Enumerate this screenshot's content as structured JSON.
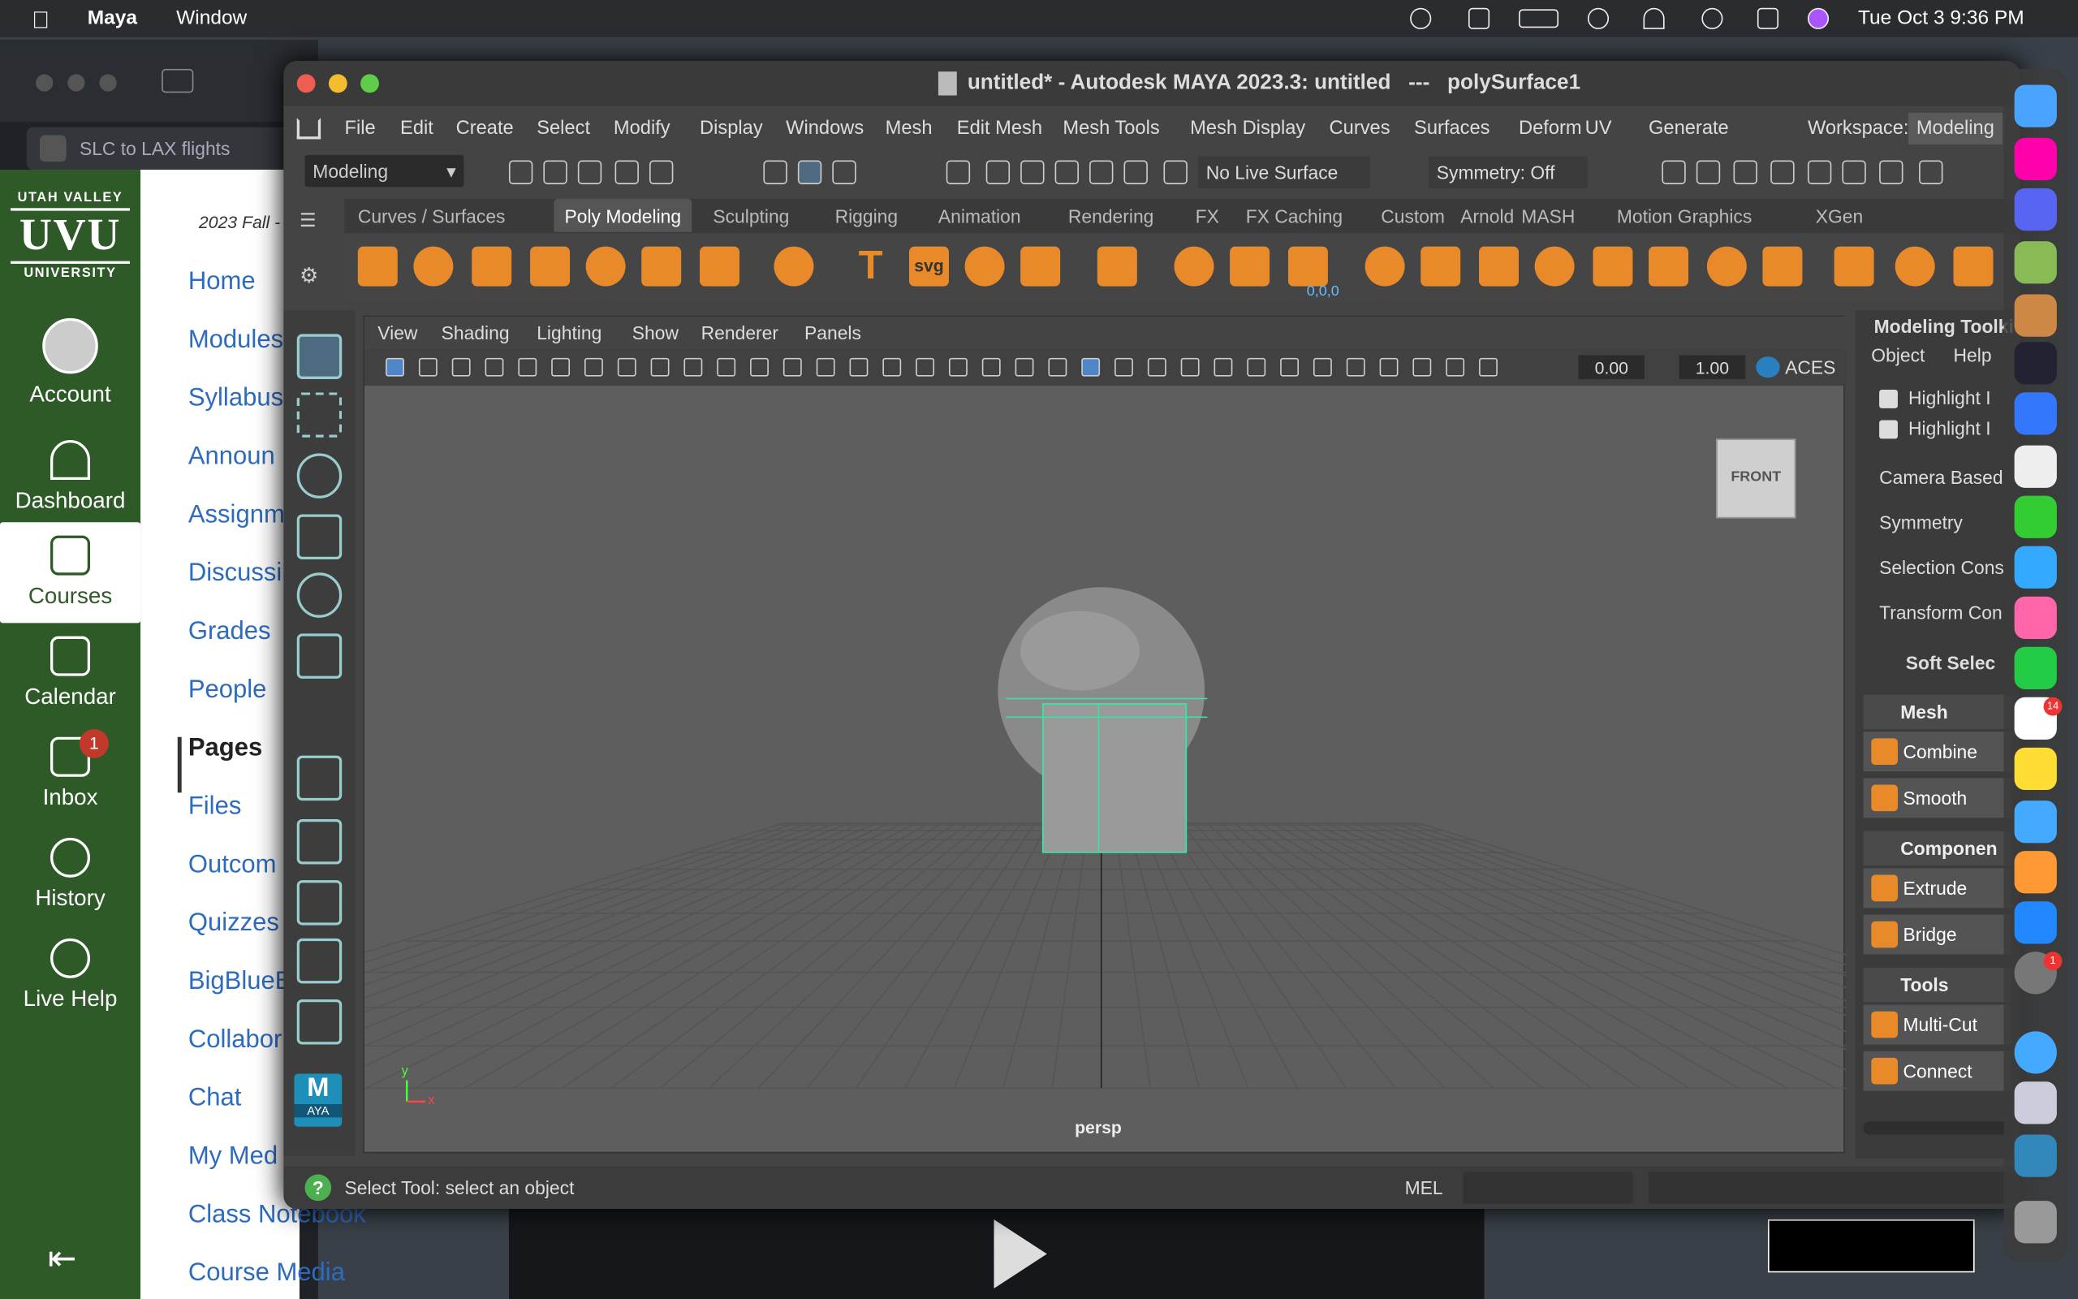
{
  "menubar": {
    "app": "Maya",
    "items": [
      "Window"
    ],
    "datetime": "Tue Oct 3  9:36 PM"
  },
  "browser_tab": "SLC to LAX flights",
  "canvas": {
    "logo_top": "UTAH VALLEY",
    "logo_mid": "UVU",
    "logo_bottom": "UNIVERSITY",
    "nav": [
      "Account",
      "Dashboard",
      "Courses",
      "Calendar",
      "Inbox",
      "History",
      "Live Help"
    ],
    "inbox_badge": "1",
    "course_term": "2023 Fall -",
    "course_links": [
      "Home",
      "Modules",
      "Syllabus",
      "Announ",
      "Assignm",
      "Discussi",
      "Grades",
      "People",
      "Pages",
      "Files",
      "Outcom",
      "Quizzes",
      "BigBlueB",
      "Collabor",
      "Chat",
      "My Med",
      "Class Notebook",
      "Course Media"
    ],
    "active_link": "Pages"
  },
  "maya": {
    "title": "untitled* - Autodesk MAYA 2023.3: untitled   ---   polySurface1",
    "menus": [
      "File",
      "Edit",
      "Create",
      "Select",
      "Modify",
      "Display",
      "Windows",
      "Mesh",
      "Edit Mesh",
      "Mesh Tools",
      "Mesh Display",
      "Curves",
      "Surfaces",
      "Deform",
      "UV",
      "Generate"
    ],
    "workspace_label": "Workspace:",
    "workspace_value": "Modeling",
    "menuset": "Modeling",
    "live_surface": "No Live Surface",
    "symmetry": "Symmetry: Off",
    "shelf_tabs": [
      "Curves / Surfaces",
      "Poly Modeling",
      "Sculpting",
      "Rigging",
      "Animation",
      "Rendering",
      "FX",
      "FX Caching",
      "Custom",
      "Arnold",
      "MASH",
      "Motion Graphics",
      "XGen"
    ],
    "active_shelf": "Poly Modeling",
    "shelf_text": {
      "svg": "svg",
      "T": "T",
      "coords": "0,0,0"
    },
    "viewport_menus": [
      "View",
      "Shading",
      "Lighting",
      "Show",
      "Renderer",
      "Panels"
    ],
    "exposure": "0.00",
    "gamma": "1.00",
    "colorspace": "ACES",
    "viewcube": "FRONT",
    "camera": "persp",
    "axis_y": "y",
    "axis_x": "x",
    "right_panel": {
      "title": "Modeling Toolkit",
      "tabs": [
        "Object",
        "Help"
      ],
      "checks": [
        "Highlight I",
        "Highlight I"
      ],
      "rows": [
        "Camera Based",
        "Symmetry",
        "Selection Cons",
        "Transform Con",
        "Soft Selec"
      ],
      "sections": [
        {
          "name": "Mesh",
          "buttons": [
            "Combine",
            "Smooth"
          ]
        },
        {
          "name": "Componen",
          "buttons": [
            "Extrude",
            "Bridge"
          ]
        },
        {
          "name": "Tools",
          "buttons": [
            "Multi-Cut",
            "Connect"
          ]
        }
      ]
    },
    "helpline": "Select Tool: select an object",
    "mel": "MEL",
    "logo": "M",
    "logo_sub": "AYA"
  },
  "dock_badges": [
    "14",
    "1"
  ]
}
